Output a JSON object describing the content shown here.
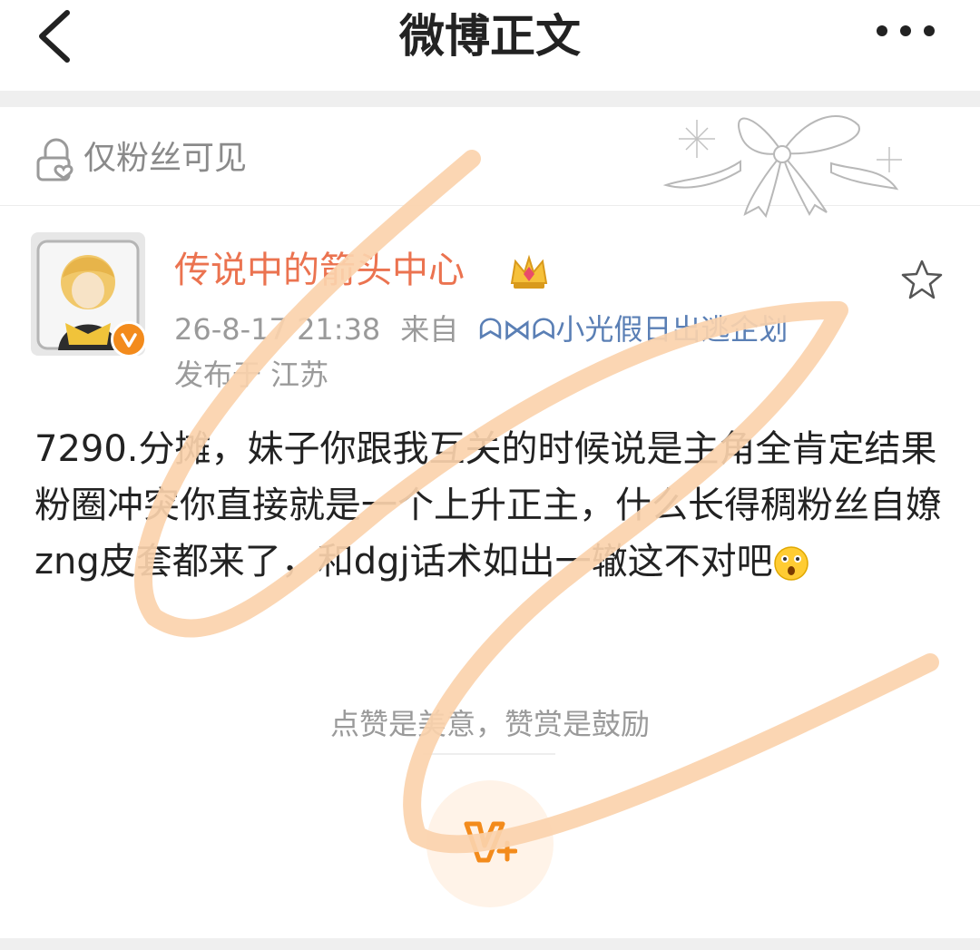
{
  "nav": {
    "title": "微博正文",
    "back_icon": "chevron-left-icon",
    "more_icon": "more-horizontal-icon"
  },
  "visibility": {
    "label": "仅粉丝可见",
    "icon": "lock-heart-icon"
  },
  "author": {
    "name": "传说中的箭头中心",
    "verified": true,
    "badge_icon": "crown-icon"
  },
  "post_meta": {
    "time": "26-8-17 21:38",
    "from_label": "来自",
    "source": "ᗣ⋈ᗣ小光假日出逃企划",
    "location": "发布于 江苏"
  },
  "post": {
    "text": "7290.分摊，妹子你跟我互关的时候说是主角全肯定结果粉圈冲突你直接就是一个上升正主，什么长得稠粉丝自嫽zng皮套都来了，和dgj话术如出一辙这不对吧",
    "emoji": "shocked-emoji-icon"
  },
  "reward": {
    "prompt": "点赞是美意，赞赏是鼓励",
    "button_icon": "reward-v-plus-icon"
  },
  "colors": {
    "accent": "#eb7350",
    "reward_orange": "#f38b1c",
    "scribble": "#fbd2ad"
  }
}
